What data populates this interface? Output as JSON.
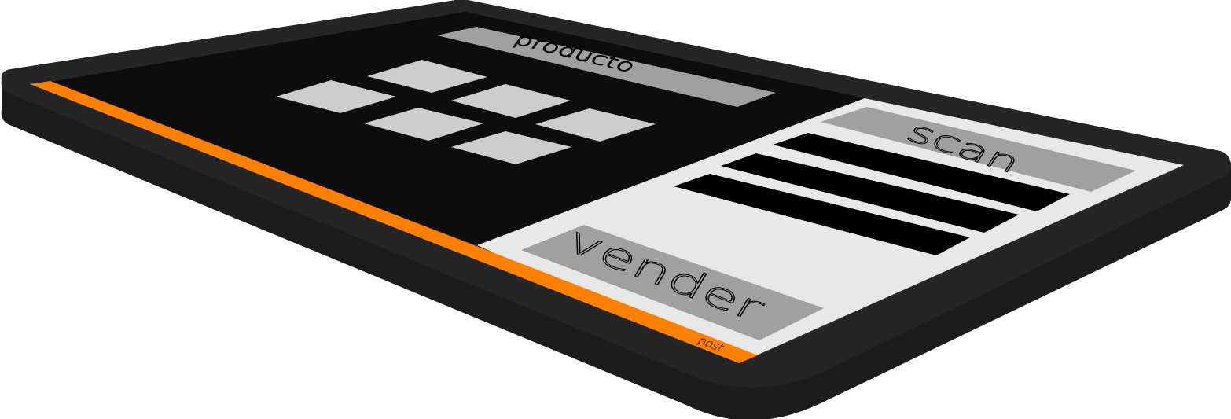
{
  "device": {
    "body_color": "#252525",
    "edge_color": "#1c1c1c",
    "screen_dark": "#0d0d0d",
    "screen_light": "#e8e8e8",
    "accent": "#ff8000"
  },
  "panels": {
    "product": {
      "label": "producto",
      "color": "#a0a0a0"
    },
    "scan": {
      "label": "scan",
      "color": "#a0a0a0"
    },
    "sell": {
      "label": "vender",
      "color": "#a0a0a0"
    }
  },
  "product_grid": {
    "tile_color": "#cdcdcd",
    "tile_count": 6
  },
  "barcode": {
    "stripe_color": "#000000",
    "stripe_count": 3
  },
  "footer": {
    "label": "post"
  }
}
